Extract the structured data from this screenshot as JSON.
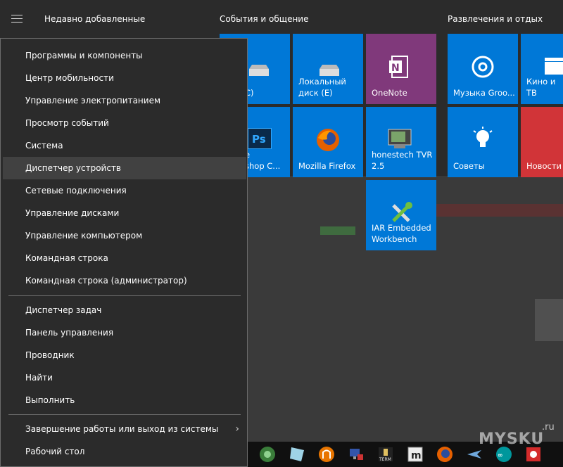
{
  "start": {
    "recent_title": "Недавно добавленные",
    "groups": [
      "События и общение",
      "Развлечения и отдых"
    ]
  },
  "tiles": [
    {
      "label": "С)",
      "color": "#0078d7",
      "icon": "drive-icon"
    },
    {
      "label": "Локальный\nдиск (E)",
      "color": "#0078d7",
      "icon": "drive-icon"
    },
    {
      "label": "OneNote",
      "color": "#80397b",
      "icon": "onenote-icon"
    },
    {
      "label": "e\nshop C...",
      "color": "#0078d7",
      "icon": "photoshop-icon"
    },
    {
      "label": "Mozilla Firefox",
      "color": "#0078d7",
      "icon": "firefox-icon"
    },
    {
      "label": "honestech TVR\n2.5",
      "color": "#0078d7",
      "icon": "tvr-icon"
    },
    {
      "label": "IAR Embedded\nWorkbench",
      "color": "#0078d7",
      "icon": "iar-tools-icon"
    },
    {
      "label": "Музыка Groo...",
      "color": "#0078d7",
      "icon": "groove-music-icon"
    },
    {
      "label": "Кино и ТВ",
      "color": "#0078d7",
      "icon": "movies-icon"
    },
    {
      "label": "Советы",
      "color": "#0078d7",
      "icon": "tips-bulb-icon"
    },
    {
      "label": "Новости",
      "color": "#d13438",
      "icon": "news-icon"
    }
  ],
  "menu": {
    "items": [
      "Программы и компоненты",
      "Центр мобильности",
      "Управление электропитанием",
      "Просмотр событий",
      "Система",
      "Диспетчер устройств",
      "Сетевые подключения",
      "Управление дисками",
      "Управление компьютером",
      "Командная строка",
      "Командная строка (администратор)",
      "Диспетчер задач",
      "Панель управления",
      "Проводник",
      "Найти",
      "Выполнить",
      "Завершение работы или выход из системы",
      "Рабочий стол"
    ],
    "highlighted": "Диспетчер устройств"
  },
  "watermark": {
    "text": "MYSKU",
    "suffix": ".ru"
  }
}
